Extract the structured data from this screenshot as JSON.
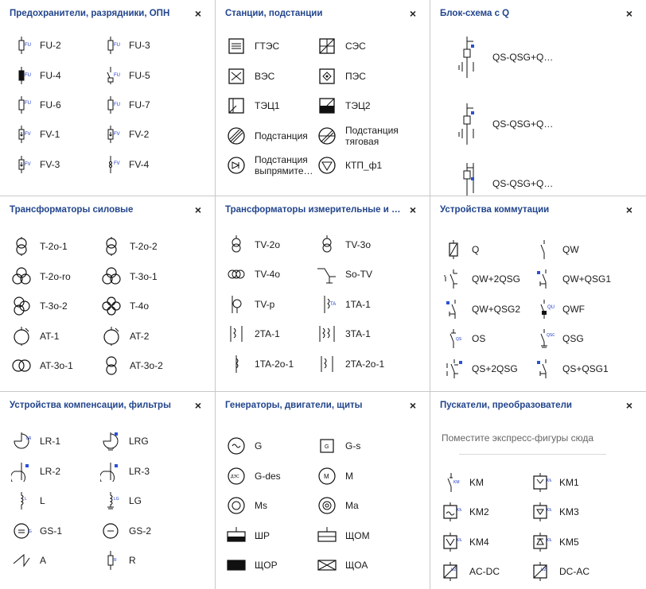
{
  "panels": [
    {
      "title": "Предохранители, разрядники, ОПН",
      "close": "×",
      "items": [
        {
          "label": "FU-2",
          "icon": "fuse-icon"
        },
        {
          "label": "FU-3",
          "icon": "fuse-icon"
        },
        {
          "label": "FU-4",
          "icon": "fuse-filled-icon"
        },
        {
          "label": "FU-5",
          "icon": "fuse-switch-icon"
        },
        {
          "label": "FU-6",
          "icon": "fuse-icon"
        },
        {
          "label": "FU-7",
          "icon": "fuse-icon"
        },
        {
          "label": "FV-1",
          "icon": "arrester-icon"
        },
        {
          "label": "FV-2",
          "icon": "arrester-icon"
        },
        {
          "label": "FV-3",
          "icon": "arrester-icon"
        },
        {
          "label": "FV-4",
          "icon": "arrester-gap-icon"
        }
      ]
    },
    {
      "title": "Станции, подстанции",
      "close": "×",
      "items": [
        {
          "label": "ГТЭС",
          "icon": "gtes-station-icon"
        },
        {
          "label": "СЭС",
          "icon": "solar-station-icon"
        },
        {
          "label": "ВЭС",
          "icon": "wind-station-icon"
        },
        {
          "label": "ПЭС",
          "icon": "tidal-station-icon"
        },
        {
          "label": "ТЭЦ1",
          "icon": "chp-station-icon"
        },
        {
          "label": "ТЭЦ2",
          "icon": "chp-station-filled-icon"
        },
        {
          "label": "Подстанция",
          "icon": "substation-icon"
        },
        {
          "label": "Подстанция тяговая",
          "icon": "traction-substation-icon"
        },
        {
          "label": "Подстанция выпрямите…",
          "icon": "rectifier-substation-icon"
        },
        {
          "label": "КТП_ф1",
          "icon": "ktp-icon"
        }
      ]
    },
    {
      "title": "Блок-схема с Q",
      "close": "×",
      "items": [
        {
          "label": "QS-QSG+Q…",
          "icon": "block-diagram-icon"
        },
        {
          "label": "QS-QSG+Q…",
          "icon": "block-diagram-icon"
        },
        {
          "label": "QS-QSG+Q…",
          "icon": "block-diagram-icon"
        }
      ]
    },
    {
      "title": "Трансформаторы силовые",
      "close": "×",
      "items": [
        {
          "label": "T-2o-1",
          "icon": "transformer-2w-icon"
        },
        {
          "label": "T-2o-2",
          "icon": "transformer-2w-icon"
        },
        {
          "label": "T-2o-ro",
          "icon": "transformer-3w-icon"
        },
        {
          "label": "T-3o-1",
          "icon": "transformer-3w-icon"
        },
        {
          "label": "T-3o-2",
          "icon": "transformer-3w-side-icon"
        },
        {
          "label": "T-4o",
          "icon": "transformer-4w-icon"
        },
        {
          "label": "AT-1",
          "icon": "autotransformer-icon"
        },
        {
          "label": "AT-2",
          "icon": "autotransformer-icon"
        },
        {
          "label": "AT-3o-1",
          "icon": "autotransformer-3w-icon"
        },
        {
          "label": "AT-3o-2",
          "icon": "autotransformer-3w-icon"
        }
      ]
    },
    {
      "title": "Трансформаторы измерительные и за…",
      "close": "×",
      "items": [
        {
          "label": "TV-2o",
          "icon": "voltage-transformer-icon"
        },
        {
          "label": "TV-3o",
          "icon": "voltage-transformer-icon"
        },
        {
          "label": "TV-4o",
          "icon": "voltage-transformer-3-icon"
        },
        {
          "label": "So-TV",
          "icon": "so-tv-icon"
        },
        {
          "label": "TV-p",
          "icon": "tv-p-icon"
        },
        {
          "label": "1TA-1",
          "icon": "current-transformer-icon"
        },
        {
          "label": "2TA-1",
          "icon": "current-transformer-2-icon"
        },
        {
          "label": "3TA-1",
          "icon": "current-transformer-3-icon"
        },
        {
          "label": "1TA-2o-1",
          "icon": "current-transformer-2o-icon"
        },
        {
          "label": "2TA-2o-1",
          "icon": "current-transformer-2-icon"
        }
      ]
    },
    {
      "title": "Устройства коммутации",
      "close": "×",
      "items": [
        {
          "label": "Q",
          "icon": "breaker-icon"
        },
        {
          "label": "QW",
          "icon": "load-switch-icon"
        },
        {
          "label": "QW+2QSG",
          "icon": "load-switch-grounds-icon"
        },
        {
          "label": "QW+QSG1",
          "icon": "load-switch-ground-icon"
        },
        {
          "label": "QW+QSG2",
          "icon": "load-switch-ground-icon"
        },
        {
          "label": "QWF",
          "icon": "fuse-switch-icon"
        },
        {
          "label": "OS",
          "icon": "disconnector-icon"
        },
        {
          "label": "QSG",
          "icon": "grounding-switch-icon"
        },
        {
          "label": "QS+2QSG",
          "icon": "disconnector-grounds-icon"
        },
        {
          "label": "QS+QSG1",
          "icon": "disconnector-ground-icon"
        }
      ]
    },
    {
      "title": "Устройства компенсации, фильтры",
      "close": "×",
      "items": [
        {
          "label": "LR-1",
          "icon": "reactor-icon"
        },
        {
          "label": "LRG",
          "icon": "reactor-ground-icon"
        },
        {
          "label": "LR-2",
          "icon": "reactor-icon"
        },
        {
          "label": "LR-3",
          "icon": "reactor-icon"
        },
        {
          "label": "L",
          "icon": "inductor-icon"
        },
        {
          "label": "LG",
          "icon": "inductor-ground-icon"
        },
        {
          "label": "GS-1",
          "icon": "compensator-icon"
        },
        {
          "label": "GS-2",
          "icon": "compensator-icon"
        },
        {
          "label": "A",
          "icon": "arrester-zigzag-icon"
        },
        {
          "label": "R",
          "icon": "resistor-icon"
        }
      ]
    },
    {
      "title": "Генераторы, двигатели, щиты",
      "close": "×",
      "items": [
        {
          "label": "G",
          "icon": "generator-icon"
        },
        {
          "label": "G-s",
          "icon": "generator-square-icon"
        },
        {
          "label": "G-des",
          "icon": "diesel-generator-icon"
        },
        {
          "label": "M",
          "icon": "motor-icon"
        },
        {
          "label": "Ms",
          "icon": "synchronous-motor-icon"
        },
        {
          "label": "Ma",
          "icon": "async-motor-icon"
        },
        {
          "label": "ШР",
          "icon": "panel-half-filled-icon"
        },
        {
          "label": "ЩОМ",
          "icon": "panel-lines-icon"
        },
        {
          "label": "ЩОР",
          "icon": "panel-filled-icon"
        },
        {
          "label": "ЩОА",
          "icon": "panel-cross-icon"
        }
      ]
    },
    {
      "title": "Пускатели, преобразователи",
      "close": "×",
      "placeholder": "Поместите экспресс-фигуры сюда",
      "items": [
        {
          "label": "KM",
          "icon": "starter-icon"
        },
        {
          "label": "KM1",
          "icon": "starter-box-icon"
        },
        {
          "label": "KM2",
          "icon": "starter-box-icon"
        },
        {
          "label": "KM3",
          "icon": "starter-box-icon"
        },
        {
          "label": "KM4",
          "icon": "starter-box-icon"
        },
        {
          "label": "KM5",
          "icon": "starter-box-icon"
        },
        {
          "label": "AC-DC",
          "icon": "converter-icon"
        },
        {
          "label": "DC-AC",
          "icon": "converter-icon"
        }
      ]
    }
  ]
}
